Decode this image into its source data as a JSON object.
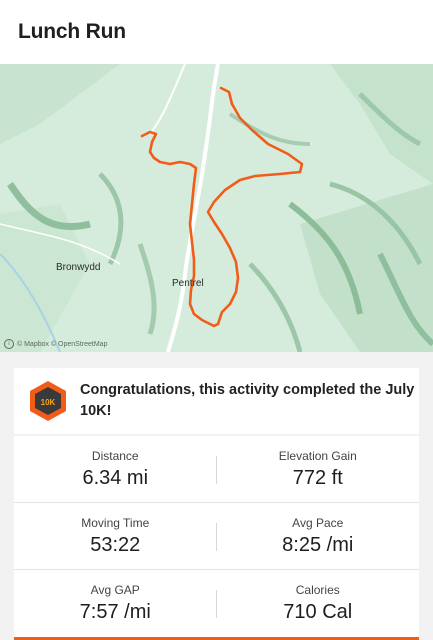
{
  "header": {
    "title": "Lunch Run"
  },
  "map": {
    "places": [
      "Bronwydd",
      "Pentrel"
    ],
    "attribution": "© Mapbox © OpenStreetMap",
    "route_color": "#f25c19"
  },
  "achievement": {
    "badge_label": "10K",
    "text": "Congratulations, this activity completed the July 10K!"
  },
  "stats": [
    {
      "label": "Distance",
      "value": "6.34 mi"
    },
    {
      "label": "Elevation Gain",
      "value": "772 ft"
    },
    {
      "label": "Moving Time",
      "value": "53:22"
    },
    {
      "label": "Avg Pace",
      "value": "8:25 /mi"
    },
    {
      "label": "Avg GAP",
      "value": "7:57 /mi"
    },
    {
      "label": "Calories",
      "value": "710 Cal"
    }
  ],
  "colors": {
    "accent": "#f25c19",
    "map_bg": "#d5ecdc"
  }
}
